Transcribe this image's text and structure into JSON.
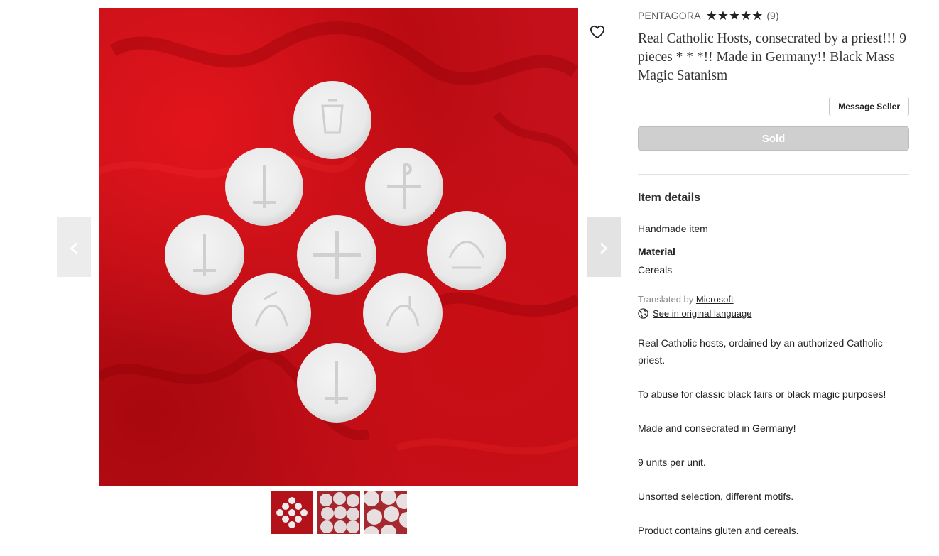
{
  "gallery": {
    "prev_icon": "chevron-left-icon",
    "next_icon": "chevron-right-icon",
    "favorite_icon": "heart-icon",
    "prev_glyph": "‹",
    "next_glyph": "›",
    "thumbnail_count": 3
  },
  "shop": {
    "name": "PENTAGORA",
    "rating_stars": 5,
    "review_count": "(9)"
  },
  "listing": {
    "title": "Real Catholic Hosts, consecrated by a priest!!! 9 pieces * * *!! Made in Germany!! Black Mass Magic Satanism",
    "message_seller_label": "Message Seller",
    "sold_label": "Sold"
  },
  "item_details": {
    "heading": "Item details",
    "handmade": "Handmade item",
    "material_label": "Material",
    "material_value": "Cereals",
    "translated_prefix": "Translated by",
    "translated_by": "Microsoft",
    "original_language_link": "See in original language",
    "globe_icon": "globe-icon"
  },
  "description": [
    "Real Catholic hosts, ordained by an authorized Catholic priest.",
    "To abuse for classic black fairs or black magic purposes!",
    "Made and consecrated in Germany!",
    "9 units per unit.",
    "Unsorted selection, different motifs.",
    "Product contains gluten and cereals."
  ],
  "colors": {
    "velvet_red": "#c4101a",
    "host_white": "#eeeeee",
    "sold_button": "#cfcfcf"
  }
}
